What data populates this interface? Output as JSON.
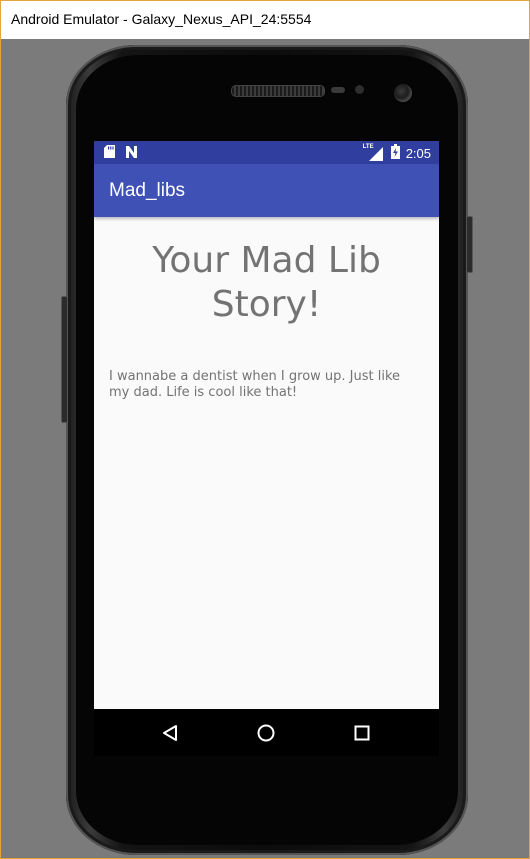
{
  "window": {
    "title": "Android Emulator - Galaxy_Nexus_API_24:5554"
  },
  "statusbar": {
    "time": "2:05",
    "network": "LTE",
    "icons": [
      "sd-card-icon",
      "n-notification-icon",
      "lte-signal-icon",
      "battery-charging-icon"
    ]
  },
  "app": {
    "title": "Mad_libs"
  },
  "content": {
    "heading": "Your Mad Lib Story!",
    "story": "I wannabe a dentist when I grow up. Just like my dad. Life is cool like that!"
  },
  "navbar": {
    "icons": [
      "back-icon",
      "home-icon",
      "recents-icon"
    ]
  },
  "colors": {
    "status_bar": "#303f9f",
    "app_bar": "#3f51b5",
    "content_bg": "#fafafa",
    "text": "#737373",
    "emulator_bg": "#7b7b7b"
  }
}
